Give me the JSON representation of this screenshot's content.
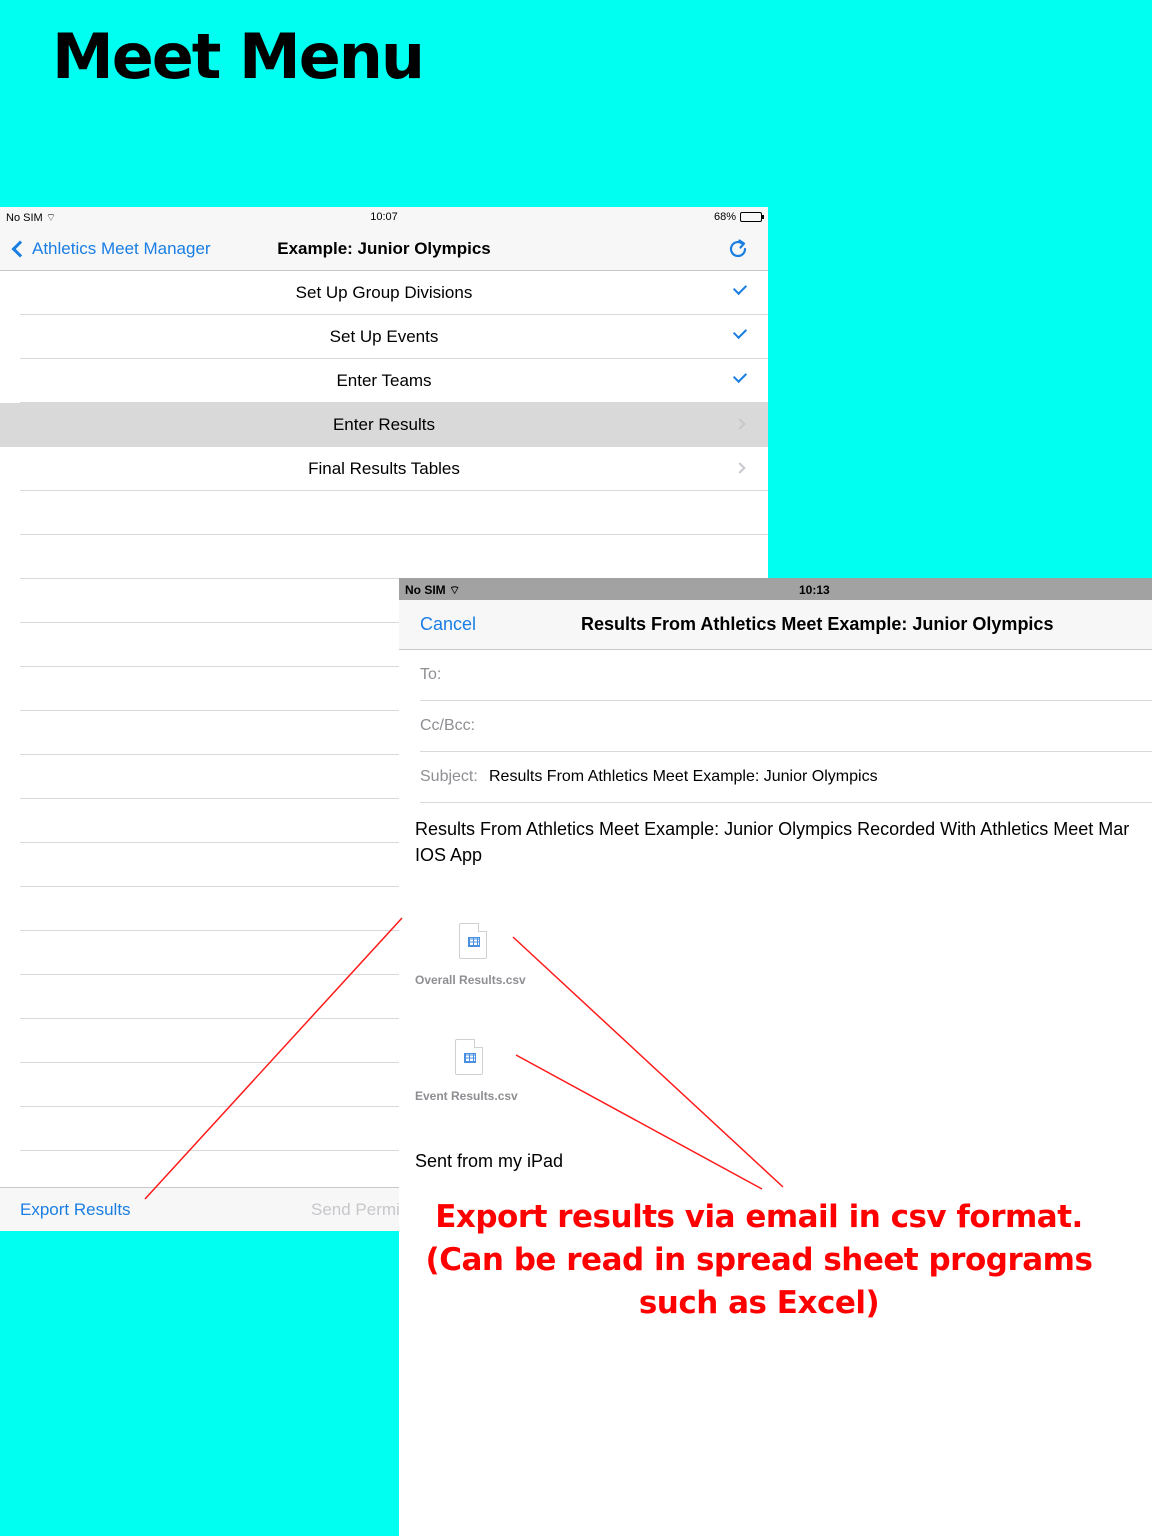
{
  "headline": "Meet Menu",
  "menu_screen": {
    "status": {
      "carrier": "No SIM",
      "time": "10:07",
      "battery": "68%"
    },
    "back_label": "Athletics Meet Manager",
    "title": "Example: Junior Olympics",
    "rows": [
      {
        "label": "Set Up Group Divisions",
        "accessory": "checkmark"
      },
      {
        "label": "Set Up Events",
        "accessory": "checkmark"
      },
      {
        "label": "Enter Teams",
        "accessory": "checkmark"
      },
      {
        "label": "Enter Results",
        "accessory": "disclosure",
        "selected": true
      },
      {
        "label": "Final Results Tables",
        "accessory": "disclosure"
      }
    ],
    "toolbar": {
      "export_label": "Export Results",
      "send_label": "Send Permi"
    }
  },
  "mail_screen": {
    "status": {
      "carrier": "No SIM",
      "time": "10:13"
    },
    "cancel_label": "Cancel",
    "title": "Results From Athletics Meet Example: Junior Olympics",
    "to_label": "To:",
    "cc_label": "Cc/Bcc:",
    "subject_label": "Subject:",
    "subject_value": "Results From Athletics Meet Example: Junior Olympics",
    "body_line1": "Results From Athletics Meet Example: Junior Olympics Recorded With Athletics Meet Mar",
    "body_line2": "IOS App",
    "attachments": [
      "Overall Results.csv",
      "Event Results.csv"
    ],
    "signature": "Sent from my iPad"
  },
  "callout": {
    "line1": "Export results via email in csv format.",
    "line2": "(Can be read in spread sheet programs",
    "line3": "such as Excel)"
  },
  "colors": {
    "background": "#00FFF0",
    "ios_blue": "#1a7ee3",
    "annotation_red": "#ff0000"
  }
}
